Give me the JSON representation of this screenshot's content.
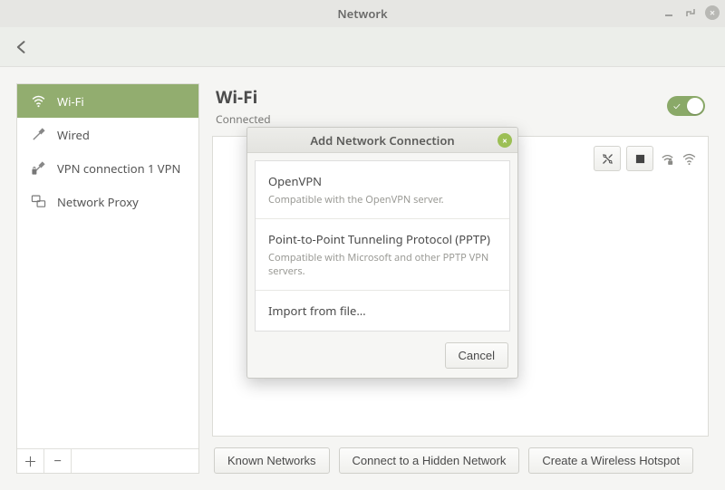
{
  "window": {
    "title": "Network"
  },
  "sidebar": {
    "items": [
      {
        "label": "Wi-Fi",
        "icon": "wifi-icon"
      },
      {
        "label": "Wired",
        "icon": "wired-icon"
      },
      {
        "label": "VPN connection 1 VPN",
        "icon": "vpn-icon"
      },
      {
        "label": "Network Proxy",
        "icon": "proxy-icon"
      }
    ]
  },
  "content": {
    "heading": "Wi-Fi",
    "status": "Connected",
    "buttons": {
      "known": "Known Networks",
      "hidden": "Connect to a Hidden Network",
      "hotspot": "Create a Wireless Hotspot"
    }
  },
  "dialog": {
    "title": "Add Network Connection",
    "options": [
      {
        "title": "OpenVPN",
        "desc": "Compatible with the OpenVPN server."
      },
      {
        "title": "Point-to-Point Tunneling Protocol (PPTP)",
        "desc": "Compatible with Microsoft and other PPTP VPN servers."
      },
      {
        "title": "Import from file…",
        "desc": ""
      }
    ],
    "cancel": "Cancel"
  }
}
